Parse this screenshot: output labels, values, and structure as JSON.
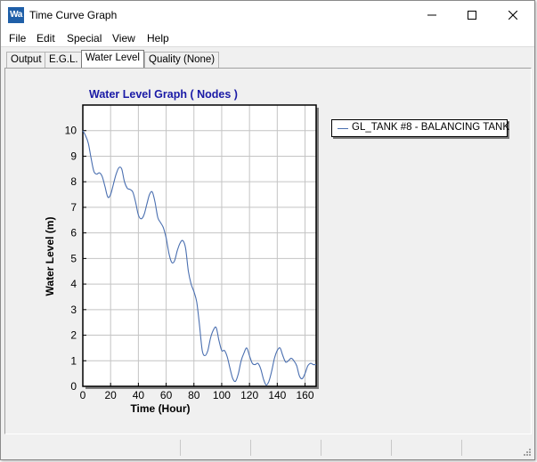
{
  "window": {
    "title": "Time Curve Graph",
    "icon_label": "Wa",
    "icons": {
      "minimize": "minimize-icon",
      "maximize": "maximize-icon",
      "close": "close-icon"
    }
  },
  "menu": [
    "File",
    "Edit",
    "Special",
    "View",
    "Help"
  ],
  "tabs": [
    {
      "label": "Output",
      "active": false
    },
    {
      "label": "E.G.L.",
      "active": false
    },
    {
      "label": "Water Level",
      "active": true
    },
    {
      "label": "Quality (None)",
      "active": false
    }
  ],
  "legend": {
    "label": "GL_TANK #8 - BALANCING TANK"
  },
  "colors": {
    "title": "#1a1aa6",
    "series": "#4a6fb0",
    "grid": "#c4c4c4"
  },
  "chart_data": {
    "type": "line",
    "title": "Water Level Graph ( Nodes )",
    "xlabel": "Time (Hour)",
    "ylabel": "Water Level (m)",
    "xlim": [
      0,
      168
    ],
    "ylim": [
      0,
      11
    ],
    "xticks": [
      0,
      20,
      40,
      60,
      80,
      100,
      120,
      140,
      160
    ],
    "yticks": [
      0,
      1,
      2,
      3,
      4,
      5,
      6,
      7,
      8,
      9,
      10
    ],
    "grid": true,
    "series": [
      {
        "name": "GL_TANK #8 - BALANCING TANK",
        "x": [
          0,
          2,
          4,
          6,
          8,
          10,
          12,
          14,
          16,
          18,
          20,
          22,
          24,
          26,
          28,
          30,
          32,
          34,
          36,
          38,
          40,
          42,
          44,
          46,
          48,
          50,
          52,
          54,
          56,
          58,
          60,
          62,
          64,
          66,
          68,
          70,
          72,
          74,
          76,
          78,
          80,
          82,
          84,
          86,
          88,
          90,
          92,
          94,
          96,
          98,
          100,
          102,
          104,
          106,
          108,
          110,
          112,
          114,
          116,
          118,
          120,
          122,
          124,
          126,
          128,
          130,
          132,
          134,
          136,
          138,
          140,
          142,
          144,
          146,
          148,
          150,
          152,
          154,
          156,
          158,
          160,
          162,
          164,
          166,
          168
        ],
        "y": [
          10.0,
          9.8,
          9.5,
          8.9,
          8.4,
          8.3,
          8.35,
          8.2,
          7.8,
          7.4,
          7.5,
          7.9,
          8.3,
          8.55,
          8.5,
          8.0,
          7.75,
          7.7,
          7.6,
          7.2,
          6.7,
          6.55,
          6.7,
          7.1,
          7.5,
          7.6,
          7.2,
          6.6,
          6.4,
          6.2,
          5.8,
          5.2,
          4.85,
          4.9,
          5.3,
          5.6,
          5.7,
          5.4,
          4.5,
          4.0,
          3.7,
          3.3,
          2.4,
          1.4,
          1.2,
          1.4,
          1.9,
          2.2,
          2.3,
          1.8,
          1.4,
          1.4,
          1.15,
          0.7,
          0.3,
          0.2,
          0.5,
          1.0,
          1.3,
          1.5,
          1.2,
          0.9,
          0.85,
          0.9,
          0.7,
          0.3,
          0.05,
          0.2,
          0.6,
          1.1,
          1.4,
          1.5,
          1.2,
          0.95,
          1.0,
          1.1,
          1.0,
          0.8,
          0.4,
          0.3,
          0.5,
          0.8,
          0.9,
          0.85,
          0.85
        ]
      }
    ]
  }
}
